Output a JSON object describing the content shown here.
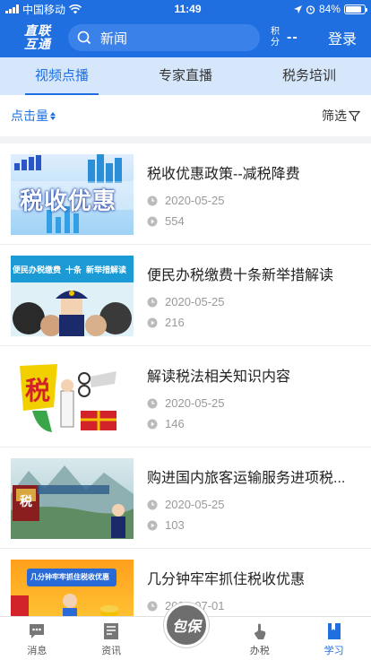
{
  "status_bar": {
    "carrier": "中国移动",
    "time": "11:49",
    "battery": "84%",
    "battery_level": 0.84
  },
  "header": {
    "logo_line1": "直联",
    "logo_line2": "互通",
    "search_text": "新闻",
    "points_label": "积分",
    "points_value": "--",
    "login_label": "登录"
  },
  "tabs": [
    {
      "label": "视频点播",
      "active": true
    },
    {
      "label": "专家直播",
      "active": false
    },
    {
      "label": "税务培训",
      "active": false
    }
  ],
  "filterbar": {
    "sort_label": "点击量",
    "filter_label": "筛选"
  },
  "videos": [
    {
      "title": "税收优惠政策--减税降费",
      "date": "2020-05-25",
      "views": "554",
      "thumb_text": "税收优惠"
    },
    {
      "title": "便民办税缴费十条新举措解读",
      "date": "2020-05-25",
      "views": "216",
      "thumb_text": "便民办税缴费  十条  新举措解读"
    },
    {
      "title": "解读税法相关知识内容",
      "date": "2020-05-25",
      "views": "146",
      "thumb_text": "税"
    },
    {
      "title": "购进国内旅客运输服务进项税...",
      "date": "2020-05-25",
      "views": "103",
      "thumb_text": "税"
    },
    {
      "title": "几分钟牢牢抓住税收优惠",
      "date": "2020-07-01",
      "views": "",
      "thumb_text": "几分钟牢牢抓住税收优惠"
    }
  ],
  "bottom_nav": [
    {
      "label": "消息",
      "icon": "message-icon",
      "active": false
    },
    {
      "label": "资讯",
      "icon": "news-icon",
      "active": false
    },
    {
      "label": "办税",
      "icon": "tap-icon",
      "active": false
    },
    {
      "label": "学习",
      "icon": "book-icon",
      "active": true
    }
  ],
  "center_button": "包保",
  "colors": {
    "brand": "#1f6fe0",
    "tab_bg": "#d7e7fb"
  }
}
